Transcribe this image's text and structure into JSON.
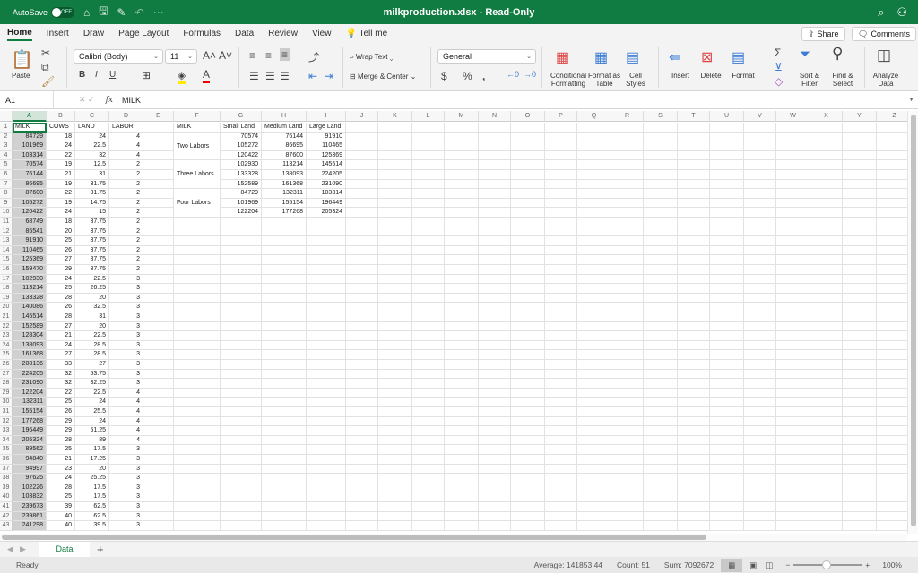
{
  "titlebar": {
    "autosave_label": "AutoSave",
    "autosave_state": "OFF",
    "title": "milkproduction.xlsx - Read-Only"
  },
  "tabs": [
    "Home",
    "Insert",
    "Draw",
    "Page Layout",
    "Formulas",
    "Data",
    "Review",
    "View",
    "Tell me"
  ],
  "share_label": "Share",
  "comments_label": "Comments",
  "ribbon": {
    "paste": "Paste",
    "font": "Calibri (Body)",
    "font_size": "11",
    "wrap_text": "Wrap Text",
    "merge_center": "Merge & Center",
    "number_format": "General",
    "conditional_formatting": "Conditional Formatting",
    "format_as_table": "Format as Table",
    "cell_styles": "Cell Styles",
    "insert": "Insert",
    "delete": "Delete",
    "format": "Format",
    "sort_filter": "Sort & Filter",
    "find_select": "Find & Select",
    "analyze_data": "Analyze Data"
  },
  "formula_bar": {
    "name_box": "A1",
    "fx": "fx",
    "value": "MILK"
  },
  "columns": [
    "A",
    "B",
    "C",
    "D",
    "E",
    "F",
    "G",
    "H",
    "I",
    "J",
    "K",
    "L",
    "M",
    "N",
    "O",
    "P",
    "Q",
    "R",
    "S",
    "T",
    "U",
    "V",
    "W",
    "X",
    "Y",
    "Z"
  ],
  "data_headers": [
    "MILK",
    "COWS",
    "LAND",
    "LABOR"
  ],
  "rows": [
    [
      84729,
      18,
      24,
      4
    ],
    [
      101969,
      24,
      22.5,
      4
    ],
    [
      103314,
      22,
      32,
      4
    ],
    [
      70574,
      19,
      12.5,
      2
    ],
    [
      76144,
      21,
      31,
      2
    ],
    [
      86695,
      19,
      31.75,
      2
    ],
    [
      87600,
      22,
      31.75,
      2
    ],
    [
      105272,
      19,
      14.75,
      2
    ],
    [
      120422,
      24,
      15,
      2
    ],
    [
      68749,
      18,
      37.75,
      2
    ],
    [
      85541,
      20,
      37.75,
      2
    ],
    [
      91910,
      25,
      37.75,
      2
    ],
    [
      110465,
      26,
      37.75,
      2
    ],
    [
      125369,
      27,
      37.75,
      2
    ],
    [
      159470,
      29,
      37.75,
      2
    ],
    [
      102930,
      24,
      22.5,
      3
    ],
    [
      113214,
      25,
      26.25,
      3
    ],
    [
      133328,
      28,
      20,
      3
    ],
    [
      140086,
      26,
      32.5,
      3
    ],
    [
      145514,
      28,
      31,
      3
    ],
    [
      152589,
      27,
      20,
      3
    ],
    [
      128304,
      21,
      22.5,
      3
    ],
    [
      138093,
      24,
      28.5,
      3
    ],
    [
      161368,
      27,
      28.5,
      3
    ],
    [
      208136,
      33,
      27,
      3
    ],
    [
      224205,
      32,
      53.75,
      3
    ],
    [
      231090,
      32,
      32.25,
      3
    ],
    [
      122204,
      22,
      22.5,
      4
    ],
    [
      132311,
      25,
      24,
      4
    ],
    [
      155154,
      26,
      25.5,
      4
    ],
    [
      177268,
      29,
      24,
      4
    ],
    [
      196449,
      29,
      51.25,
      4
    ],
    [
      205324,
      28,
      89,
      4
    ],
    [
      89562,
      25,
      17.5,
      3
    ],
    [
      94840,
      21,
      17.25,
      3
    ],
    [
      94997,
      23,
      20,
      3
    ],
    [
      97625,
      24,
      25.25,
      3
    ],
    [
      102226,
      28,
      17.5,
      3
    ],
    [
      103832,
      25,
      17.5,
      3
    ],
    [
      239673,
      39,
      62.5,
      3
    ],
    [
      239861,
      40,
      62.5,
      3
    ],
    [
      241298,
      40,
      39.5,
      3
    ]
  ],
  "pivot": {
    "corner": "MILK",
    "headers": [
      "Small Land",
      "Medium Land",
      "Large Land"
    ],
    "groups": [
      {
        "label": "Two Labors",
        "rows": [
          [
            70574,
            76144,
            91910
          ],
          [
            105272,
            86695,
            110465
          ],
          [
            120422,
            87600,
            125369
          ]
        ]
      },
      {
        "label": "Three Labors",
        "rows": [
          [
            102930,
            113214,
            145514
          ],
          [
            133328,
            138093,
            224205
          ],
          [
            152589,
            161368,
            231090
          ]
        ]
      },
      {
        "label": "Four Labors",
        "rows": [
          [
            84729,
            132311,
            103314
          ],
          [
            101969,
            155154,
            196449
          ],
          [
            122204,
            177268,
            205324
          ]
        ]
      }
    ]
  },
  "sheet_tab": "Data",
  "status": {
    "ready": "Ready",
    "average": "Average: 141853.44",
    "count": "Count: 51",
    "sum": "Sum: 7092672",
    "zoom": "100%"
  }
}
